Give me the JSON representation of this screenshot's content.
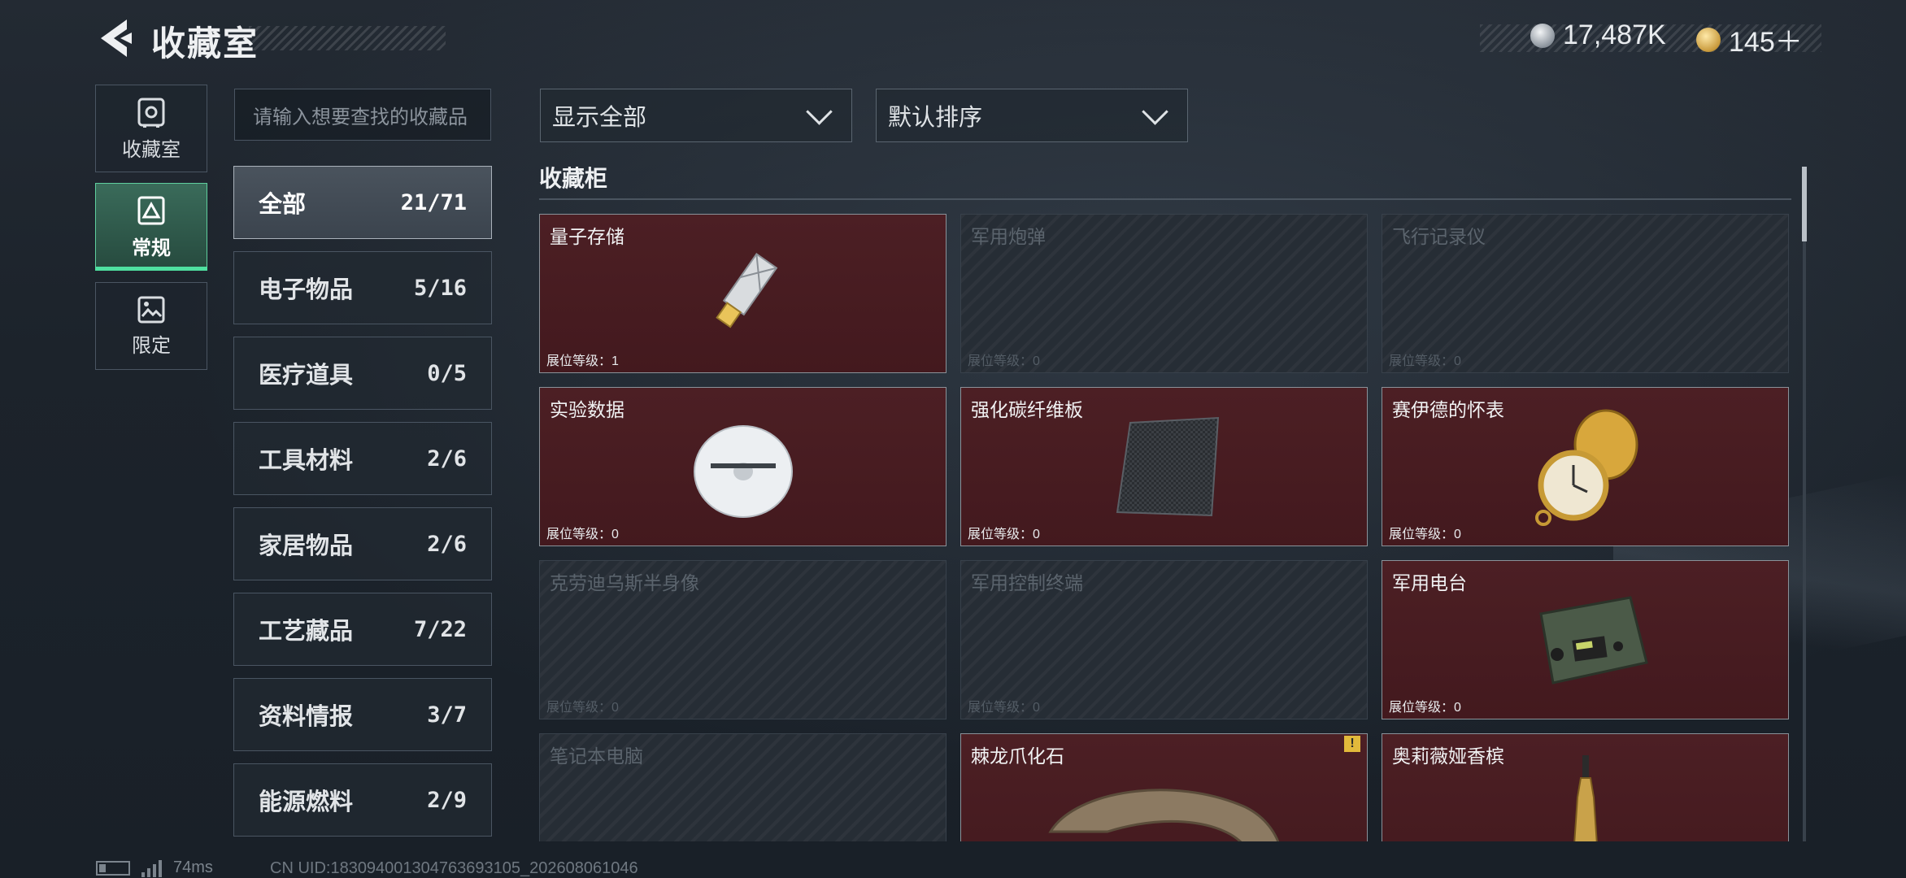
{
  "header": {
    "title": "收藏室",
    "currency_silver": "17,487K",
    "currency_gold": "145＋"
  },
  "rail": {
    "items": [
      {
        "label": "收藏室",
        "icon": "vault-icon"
      },
      {
        "label": "常规",
        "icon": "picture-frame-icon"
      },
      {
        "label": "限定",
        "icon": "landscape-image-icon"
      }
    ]
  },
  "search": {
    "placeholder": "请输入想要查找的收藏品"
  },
  "categories": [
    {
      "name": "全部",
      "count": "21/71"
    },
    {
      "name": "电子物品",
      "count": "5/16"
    },
    {
      "name": "医疗道具",
      "count": "0/5"
    },
    {
      "name": "工具材料",
      "count": "2/6"
    },
    {
      "name": "家居物品",
      "count": "2/6"
    },
    {
      "name": "工艺藏品",
      "count": "7/22"
    },
    {
      "name": "资料情报",
      "count": "3/7"
    },
    {
      "name": "能源燃料",
      "count": "2/9"
    }
  ],
  "filters": {
    "display": "显示全部",
    "sort": "默认排序"
  },
  "section_title": "收藏柜",
  "items": [
    {
      "name": "量子存储",
      "level": "展位等级：1",
      "owned": true
    },
    {
      "name": "军用炮弹",
      "level": "展位等级：0",
      "owned": false
    },
    {
      "name": "飞行记录仪",
      "level": "展位等级：0",
      "owned": false
    },
    {
      "name": "实验数据",
      "level": "展位等级：0",
      "owned": true
    },
    {
      "name": "强化碳纤维板",
      "level": "展位等级：0",
      "owned": true
    },
    {
      "name": "赛伊德的怀表",
      "level": "展位等级：0",
      "owned": true
    },
    {
      "name": "克劳迪乌斯半身像",
      "level": "展位等级：0",
      "owned": false
    },
    {
      "name": "军用控制终端",
      "level": "展位等级：0",
      "owned": false
    },
    {
      "name": "军用电台",
      "level": "展位等级：0",
      "owned": true
    },
    {
      "name": "笔记本电脑",
      "level": "",
      "owned": false
    },
    {
      "name": "棘龙爪化石",
      "level": "",
      "owned": true,
      "warning": "!"
    },
    {
      "name": "奥莉薇娅香槟",
      "level": "",
      "owned": true
    }
  ],
  "status": {
    "ping": "74ms",
    "uid": "CN UID:1830940013047636931​05_202608061046"
  },
  "colors": {
    "accent_green": "#4fe0a0",
    "owned_card": "#4c1f24",
    "warning": "#e2b93b"
  }
}
